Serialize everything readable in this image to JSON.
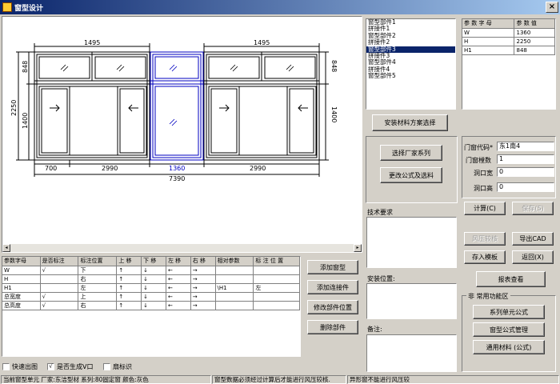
{
  "window": {
    "title": "窗型设计"
  },
  "drawing": {
    "dims": {
      "top_left": "1495",
      "top_right": "1495",
      "left_h1": "848",
      "left_h2": "1400",
      "left_total": "2250",
      "right_h1": "848",
      "right_h2": "1400",
      "bot_a": "700",
      "bot_b": "2990",
      "bot_c": "1360",
      "bot_d": "2990",
      "bot_total": "7390"
    }
  },
  "parts_list": {
    "items": [
      "窗型部件1",
      "拼接件1",
      "窗型部件2",
      "拼接件2",
      "窗型部件3",
      "拼接件3",
      "窗型部件4",
      "拼接件4",
      "窗型部件5"
    ],
    "selected_index": 4
  },
  "params_table": {
    "headers": [
      "参 数 字 母",
      "参 数 值"
    ],
    "rows": [
      [
        "W",
        "1360"
      ],
      [
        "H",
        "2250"
      ],
      [
        "H1",
        "848"
      ]
    ]
  },
  "buttons": {
    "install_scheme": "安装材料方案选择",
    "select_vendor": "选择厂家系列",
    "modify_formula": "更改公式及选料",
    "add_window": "添加窗型",
    "add_connector": "添加连接件",
    "modify_position": "修改部件位置",
    "delete_part": "删除部件",
    "calculate": "计算(C)",
    "save": "保存(S)",
    "wind_check": "风压较核",
    "export_cad": "导出CAD",
    "save_template": "存入模板",
    "back": "返回(X)",
    "view_report": "报表查看",
    "series_formula": "系列单元公式",
    "window_formula": "窗型公式管理",
    "common_material": "通用材料 (公式)"
  },
  "form": {
    "door_code_label": "门窗代码*",
    "door_code_value": "东1南4",
    "count_label": "门窗樘数",
    "count_value": "1",
    "hole_w_label": "洞口宽",
    "hole_w_value": "0",
    "hole_h_label": "洞口高",
    "hole_h_value": "0"
  },
  "sections": {
    "tech_req": "技术要求",
    "install_pos": "安装位置:",
    "remarks": "备注:",
    "common_area": "常用功能区"
  },
  "grid": {
    "headers": [
      "参数字母",
      "是否标注",
      "标注位置",
      "上 移",
      "下 移",
      "左 移",
      "右 移",
      "相对参数",
      "标 注 位 置"
    ],
    "rows": [
      [
        "W",
        "√",
        "下",
        "↑",
        "↓",
        "←",
        "→",
        "",
        ""
      ],
      [
        "H",
        "",
        "右",
        "↑",
        "↓",
        "←",
        "→",
        "",
        ""
      ],
      [
        "H1",
        "",
        "左",
        "↑",
        "↓",
        "←",
        "→",
        "\\H1",
        "左"
      ],
      [
        "总宽度",
        "√",
        "上",
        "↑",
        "↓",
        "←",
        "→",
        "",
        ""
      ],
      [
        "总高度",
        "√",
        "右",
        "↑",
        "↓",
        "←",
        "→",
        "",
        ""
      ]
    ]
  },
  "checkboxes": {
    "quick_draw": "快速出图",
    "gen_v": "是否生成V口",
    "fan_mark": "扇标识",
    "gen_v_checked": "√"
  },
  "status": {
    "s1": "当前窗型单元 厂家:东洁型材 系列:80固定窗 颜色:灰色",
    "s2": "窗型数据必须经过计算后才能进行风压较核.",
    "s3": "异形窗不能进行风压较"
  }
}
